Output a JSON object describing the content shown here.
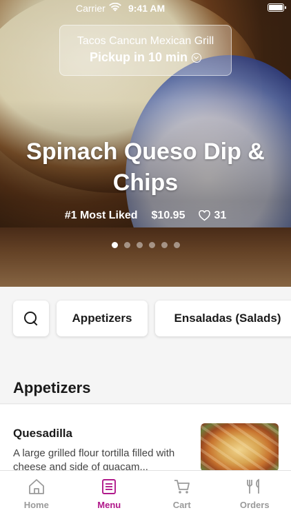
{
  "status_bar": {
    "carrier": "Carrier",
    "time": "9:41 AM"
  },
  "location": {
    "restaurant": "Tacos Cancun Mexican Grill",
    "pickup": "Pickup in 10 min"
  },
  "hero": {
    "title": "Spinach Queso Dip & Chips",
    "rank": "#1 Most Liked",
    "price": "$10.95",
    "likes": "31",
    "carousel_count": 6,
    "carousel_active_index": 0
  },
  "categories": {
    "items": [
      "Appetizers",
      "Ensaladas (Salads)"
    ]
  },
  "section": {
    "title": "Appetizers"
  },
  "menu_item": {
    "name": "Quesadilla",
    "description": "A large grilled flour tortilla filled with cheese and side of guacam..."
  },
  "tabs": [
    {
      "label": "Home",
      "icon": "home-icon"
    },
    {
      "label": "Menu",
      "icon": "menu-icon"
    },
    {
      "label": "Cart",
      "icon": "cart-icon"
    },
    {
      "label": "Orders",
      "icon": "orders-icon"
    }
  ],
  "colors": {
    "accent": "#b0188a",
    "tab_inactive": "#9a9a9a"
  }
}
